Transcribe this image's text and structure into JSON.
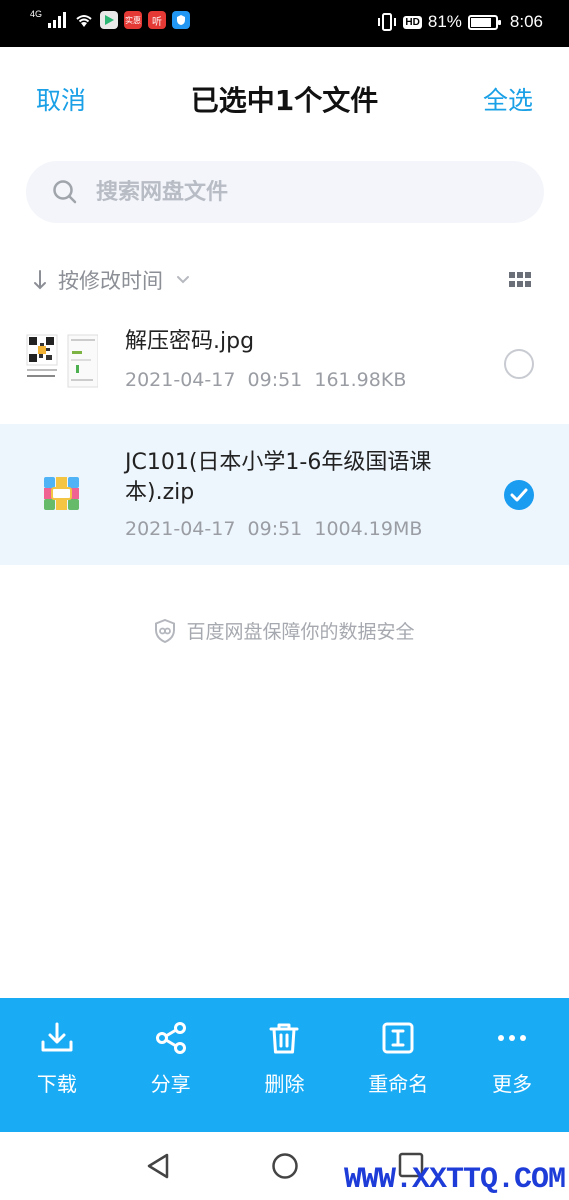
{
  "status_bar": {
    "network": "4G",
    "battery_percent": "81%",
    "time": "8:06",
    "hd_badge": "HD",
    "notif_app_1": "实惠",
    "notif_app_2": "听"
  },
  "header": {
    "cancel_label": "取消",
    "title": "已选中1个文件",
    "select_all_label": "全选"
  },
  "search": {
    "placeholder": "搜索网盘文件"
  },
  "sort": {
    "label": "按修改时间"
  },
  "files": [
    {
      "name": "解压密码.jpg",
      "date": "2021-04-17",
      "time": "09:51",
      "size": "161.98KB",
      "selected": false
    },
    {
      "name": "JC101(日本小学1-6年级国语课本).zip",
      "date": "2021-04-17",
      "time": "09:51",
      "size": "1004.19MB",
      "selected": true
    }
  ],
  "security_note": "百度网盘保障你的数据安全",
  "toolbar": {
    "download_label": "下载",
    "share_label": "分享",
    "delete_label": "删除",
    "rename_label": "重命名",
    "more_label": "更多"
  },
  "watermark": "WWW.XXTTQ.COM",
  "colors": {
    "accent": "#1aa0e6",
    "toolbar_bg": "#1aabf5",
    "selected_row_bg": "#eef6fd"
  }
}
